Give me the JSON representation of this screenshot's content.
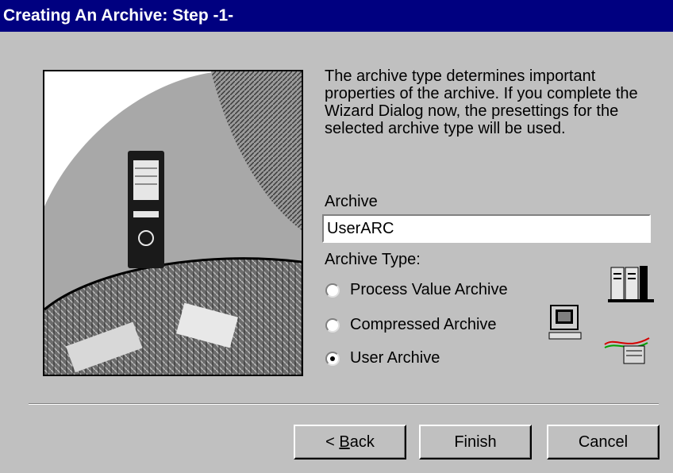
{
  "window": {
    "title": "Creating An Archive: Step -1-"
  },
  "description": "The archive type determines important properties of the archive. If you complete the Wizard Dialog now, the presettings for the selected archive type will be used.",
  "archive": {
    "label": "Archive",
    "value": "UserARC"
  },
  "archive_type": {
    "label": "Archive Type:",
    "options": [
      {
        "label": "Process Value Archive",
        "selected": false,
        "icon": "server-icon"
      },
      {
        "label": "Compressed Archive",
        "selected": false,
        "icon": "computer-icon"
      },
      {
        "label": "User Archive",
        "selected": true,
        "icon": "network-device-icon"
      }
    ]
  },
  "buttons": {
    "back_prefix": "< ",
    "back_accel": "B",
    "back_rest": "ack",
    "finish": "Finish",
    "cancel": "Cancel"
  },
  "colors": {
    "titlebar": "#000080",
    "face": "#c0c0c0"
  }
}
